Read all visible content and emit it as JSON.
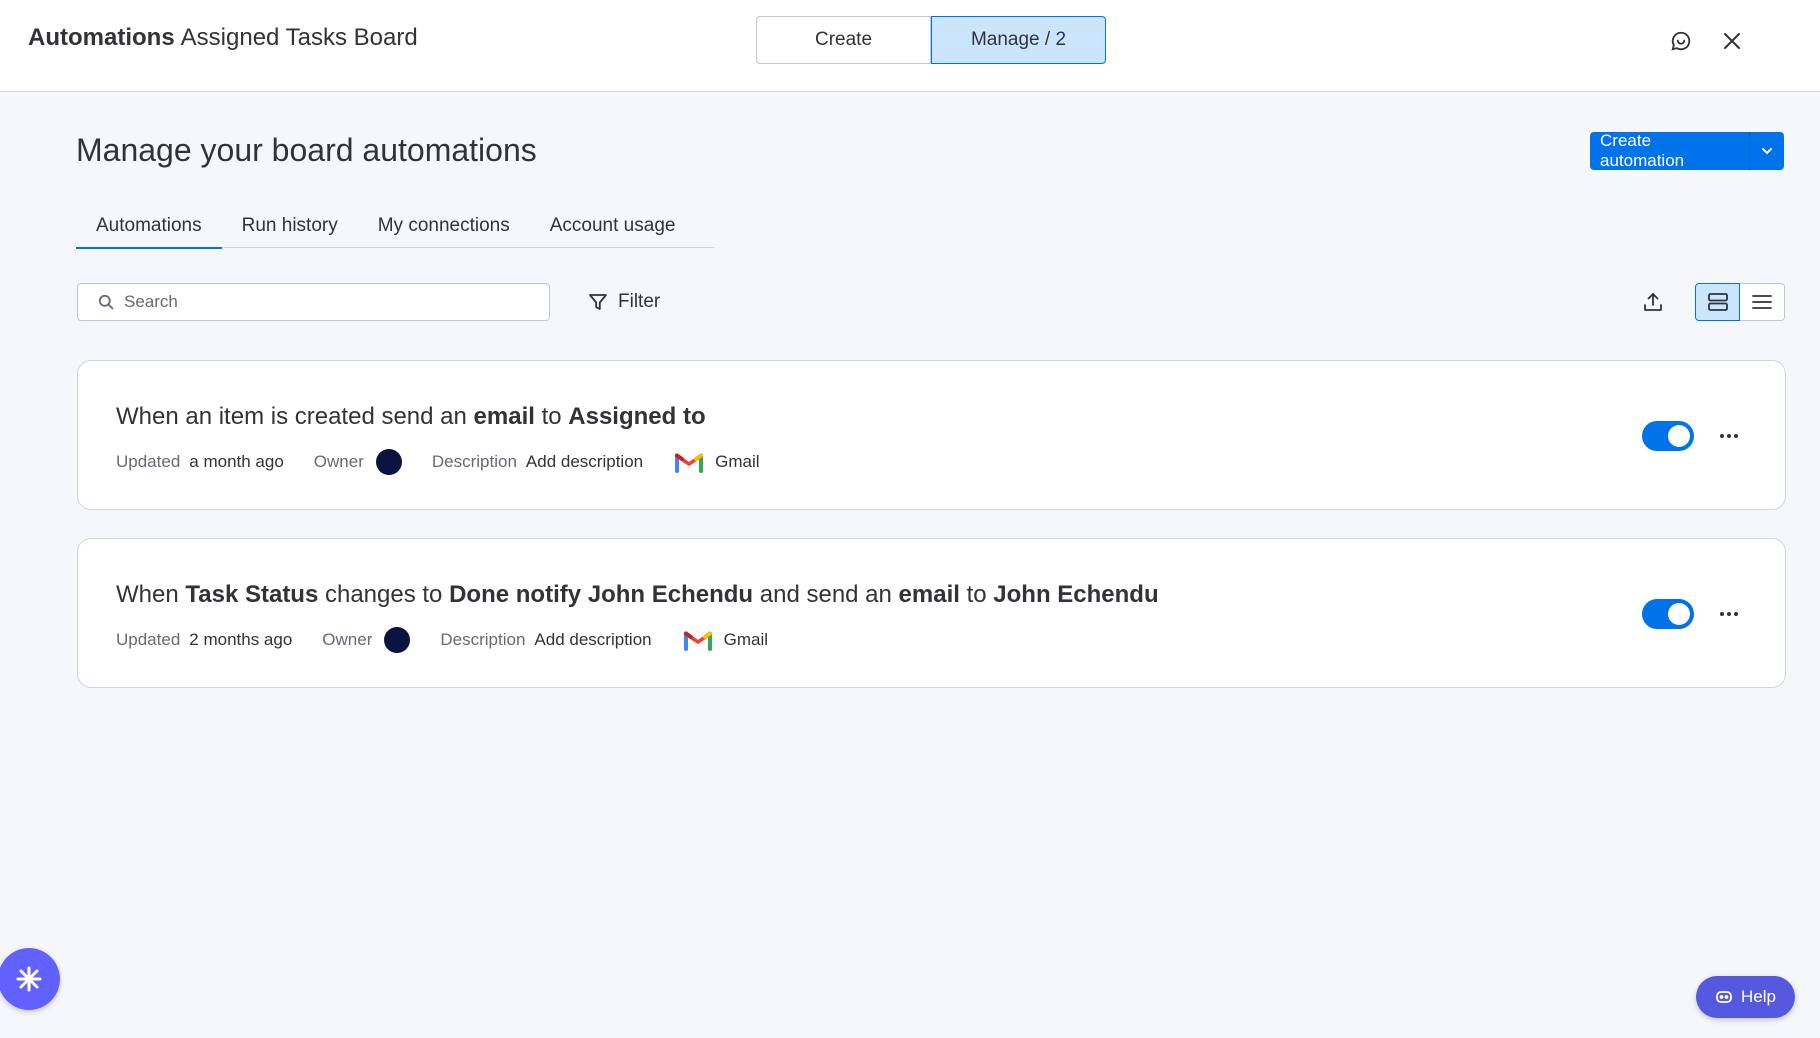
{
  "header": {
    "title_bold": "Automations",
    "board_name": "Assigned Tasks Board",
    "modes": [
      {
        "label": "Create"
      },
      {
        "label": "Manage / 2"
      }
    ]
  },
  "page": {
    "title": "Manage your board automations",
    "create_button": "Create automation"
  },
  "tabs": [
    {
      "label": "Automations",
      "active": true
    },
    {
      "label": "Run history"
    },
    {
      "label": "My connections"
    },
    {
      "label": "Account usage"
    }
  ],
  "toolbar": {
    "search_placeholder": "Search",
    "filter_label": "Filter"
  },
  "automations": [
    {
      "title_parts": [
        {
          "text": "When an item is created send an ",
          "bold": false
        },
        {
          "text": "email",
          "bold": true
        },
        {
          "text": " to ",
          "bold": false
        },
        {
          "text": "Assigned to",
          "bold": true
        }
      ],
      "updated_label": "Updated",
      "updated_value": "a month ago",
      "owner_label": "Owner",
      "description_label": "Description",
      "description_value": "Add description",
      "integration": "Gmail",
      "enabled": true
    },
    {
      "title_parts": [
        {
          "text": "When ",
          "bold": false
        },
        {
          "text": "Task Status",
          "bold": true
        },
        {
          "text": " changes to ",
          "bold": false
        },
        {
          "text": "Done",
          "bold": true
        },
        {
          "text": " ",
          "bold": false
        },
        {
          "text": "notify",
          "bold": true
        },
        {
          "text": " ",
          "bold": false
        },
        {
          "text": "John Echendu",
          "bold": true
        },
        {
          "text": " and send an ",
          "bold": false
        },
        {
          "text": "email",
          "bold": true
        },
        {
          "text": " to ",
          "bold": false
        },
        {
          "text": "John Echendu",
          "bold": true
        }
      ],
      "updated_label": "Updated",
      "updated_value": "2 months ago",
      "owner_label": "Owner",
      "description_label": "Description",
      "description_value": "Add description",
      "integration": "Gmail",
      "enabled": true
    }
  ],
  "help": {
    "label": "Help"
  },
  "colors": {
    "primary": "#0073ea",
    "selected_bg": "#cce5ff",
    "help_bg": "#5559df",
    "fab_bg": "#6161ff",
    "avatar": "#0b1340"
  },
  "icons": {
    "feedback": "chat-bubble-icon",
    "close": "close-icon",
    "search": "search-icon",
    "filter": "filter-icon",
    "export": "upload-icon",
    "cards_view": "cards-view-icon",
    "list_view": "list-view-icon",
    "more": "more-horizontal-icon",
    "gmail": "gmail-icon",
    "help": "robot-icon",
    "fab": "snowflake-icon"
  }
}
